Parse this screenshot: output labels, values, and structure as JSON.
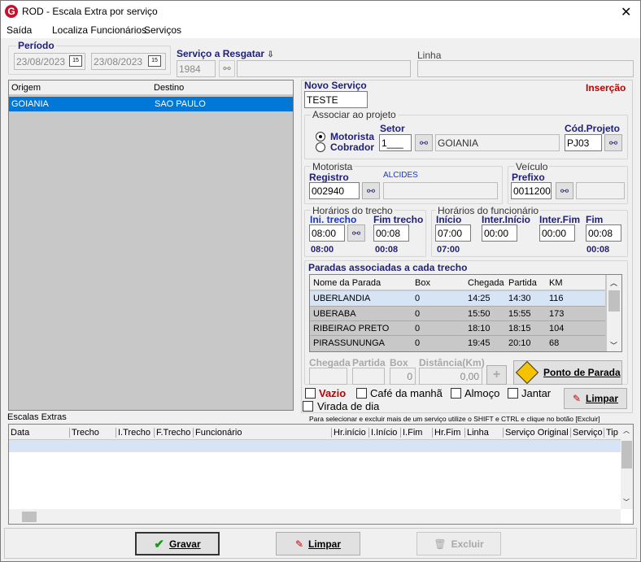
{
  "window": {
    "title": "ROD - Escala Extra por serviço",
    "close_glyph": "✕",
    "app_icon": "G"
  },
  "menu": [
    "Saída",
    "Localiza Funcionários",
    "Serviços"
  ],
  "periodo": {
    "label": "Período",
    "date_from": "23/08/2023",
    "date_to": "23/08/2023",
    "cal_icon": "15"
  },
  "servico_resgatar": {
    "label": "Serviço a Resgatar",
    "value": "1984"
  },
  "linha": {
    "label": "Linha"
  },
  "left_list": {
    "headers": [
      "Origem",
      "Destino"
    ],
    "rows": [
      {
        "origem": "GOIANIA",
        "destino": "SAO PAULO"
      }
    ]
  },
  "novo_servico": {
    "label": "Novo Serviço",
    "value": "TESTE",
    "status": "Inserção"
  },
  "projeto": {
    "legend": "Associar ao projeto",
    "radio1": "Motorista",
    "radio2": "Cobrador",
    "setor_label": "Setor",
    "setor_value": "1___",
    "setor_name": "GOIANIA",
    "cod_label": "Cód.Projeto",
    "cod_value": "PJ03"
  },
  "motorista": {
    "legend": "Motorista",
    "registro_label": "Registro",
    "registro_value": "002940",
    "name": "ALCIDES"
  },
  "veiculo": {
    "legend": "Veículo",
    "prefixo_label": "Prefixo",
    "prefixo_value": "0011200"
  },
  "horarios_trecho": {
    "legend": "Horários do trecho",
    "ini_label": "Ini. trecho",
    "ini_value": "08:00",
    "fim_label": "Fim trecho",
    "fim_value": "00:08",
    "ini_under": "08:00",
    "fim_under": "00:08"
  },
  "horarios_func": {
    "legend": "Horários do funcionário",
    "inicio_label": "Início",
    "inicio_value": "07:00",
    "inter_ini_label": "Inter.Início",
    "inter_ini_value": "00:00",
    "inter_fim_label": "Inter.Fim",
    "inter_fim_value": "00:00",
    "fim_label": "Fim",
    "fim_value": "00:08",
    "inicio_under": "07:00",
    "fim_under": "00:08"
  },
  "paradas": {
    "title": "Paradas associadas a cada trecho",
    "headers": [
      "Nome da Parada",
      "Box",
      "Chegada",
      "Partida",
      "KM"
    ],
    "rows": [
      [
        "UBERLANDIA",
        "0",
        "14:25",
        "14:30",
        "116"
      ],
      [
        "UBERABA",
        "0",
        "15:50",
        "15:55",
        "173"
      ],
      [
        "RIBEIRAO PRETO",
        "0",
        "18:10",
        "18:15",
        "104"
      ],
      [
        "PIRASSUNUNGA",
        "0",
        "19:45",
        "20:10",
        "68"
      ]
    ],
    "chegada_label": "Chegada",
    "partida_label": "Partida",
    "box_label": "Box",
    "distancia_label": "Distância(Km)",
    "box_value": "0",
    "dist_value": "0,00",
    "plus": "+",
    "ponto_button": "Ponto de Parada"
  },
  "checks": {
    "vazio": "Vazio",
    "cafe": "Café da manhã",
    "almoco": "Almoço",
    "jantar": "Jantar",
    "virada": "Virada de dia",
    "limpar": "Limpar"
  },
  "escalas": {
    "label": "Escalas Extras",
    "hint": "Para selecionar e excluir mais de um serviço utilize o SHIFT e CTRL e clique no botão [Excluir]",
    "headers": [
      "Data",
      "Trecho",
      "I.Trecho",
      "F.Trecho",
      "Funcionário",
      "Hr.início",
      "I.Início",
      "I.Fim",
      "Hr.Fim",
      "Linha",
      "Serviço Original",
      "Serviço",
      "Tip"
    ]
  },
  "footer": {
    "gravar": "Gravar",
    "limpar": "Limpar",
    "excluir": "Excluir"
  }
}
